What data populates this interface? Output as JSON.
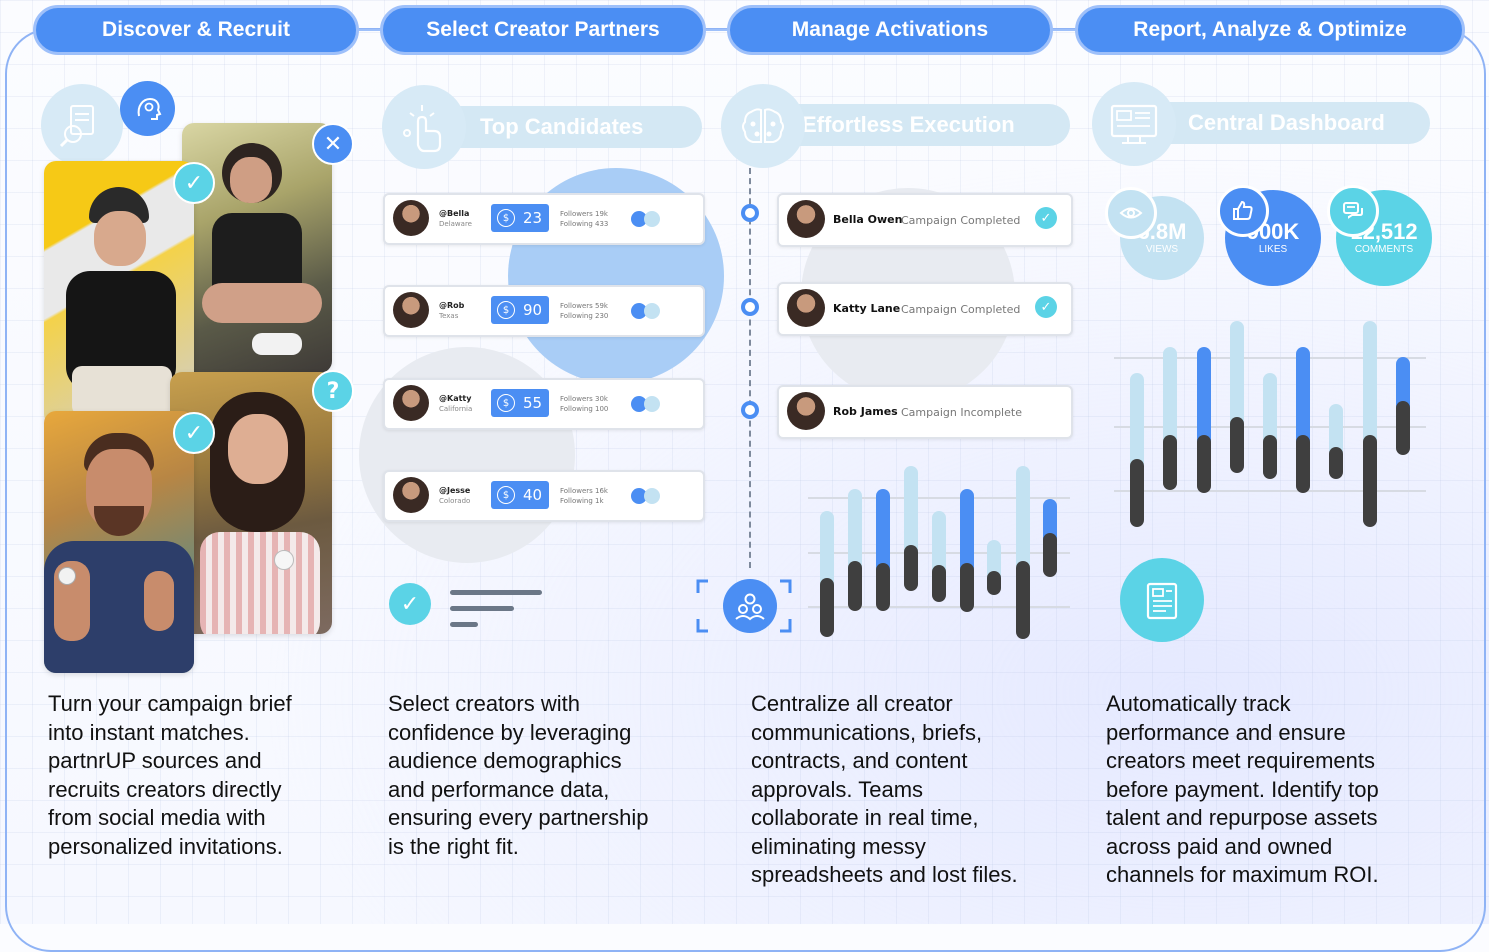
{
  "headers": [
    "Discover & Recruit",
    "Select Creator Partners",
    "Manage Activations",
    "Report, Analyze & Optimize"
  ],
  "sections": {
    "top_candidates": "Top Candidates",
    "effortless_execution": "Effortless Execution",
    "central_dashboard": "Central Dashboard"
  },
  "badges": {
    "check": "✓",
    "close": "✕",
    "question": "?"
  },
  "candidates": [
    {
      "handle": "@Bella",
      "location": "Delaware",
      "price": "23",
      "followers": "Followers 19k",
      "following": "Following 433"
    },
    {
      "handle": "@Rob",
      "location": "Texas",
      "price": "90",
      "followers": "Followers 59k",
      "following": "Following 230"
    },
    {
      "handle": "@Katty",
      "location": "California",
      "price": "55",
      "followers": "Followers 30k",
      "following": "Following 100"
    },
    {
      "handle": "@Jesse",
      "location": "Colorado",
      "price": "40",
      "followers": "Followers 16k",
      "following": "Following 1k"
    }
  ],
  "currency_symbol": "$",
  "activations": [
    {
      "name": "Bella Owen",
      "status": "Campaign Completed",
      "done": true
    },
    {
      "name": "Katty Lane",
      "status": "Campaign Completed",
      "done": true
    },
    {
      "name": "Rob James",
      "status": "Campaign Incomplete",
      "done": false
    }
  ],
  "metrics": [
    {
      "value": "6.8M",
      "label": "VIEWS",
      "icon": "eye-icon"
    },
    {
      "value": "900K",
      "label": "LIKES",
      "icon": "thumbs-up-icon"
    },
    {
      "value": "12,512",
      "label": "COMMENTS",
      "icon": "comment-icon"
    }
  ],
  "descriptions": [
    [
      "Turn your campaign brief",
      "into instant matches.",
      "partnrUP sources and",
      "recruits creators directly",
      "from social media with",
      "personalized invitations."
    ],
    [
      "Select creators with",
      "confidence by leveraging",
      "audience demographics",
      "and performance data,",
      "ensuring every partnership",
      "is the right fit."
    ],
    [
      "Centralize all creator",
      "communications, briefs,",
      "contracts, and content",
      "approvals. Teams",
      "collaborate in real time,",
      "eliminating messy",
      "spreadsheets and lost files."
    ],
    [
      "Automatically track",
      "performance and ensure",
      "creators meet requirements",
      "before payment. Identify top",
      "talent and repurpose assets",
      "across paid and owned",
      "channels for maximum ROI."
    ]
  ],
  "colors": {
    "primary": "#4b8ef3",
    "light_blue": "#c3e2f2",
    "cyan": "#5bd3e6",
    "dark": "#3f3f3f"
  }
}
